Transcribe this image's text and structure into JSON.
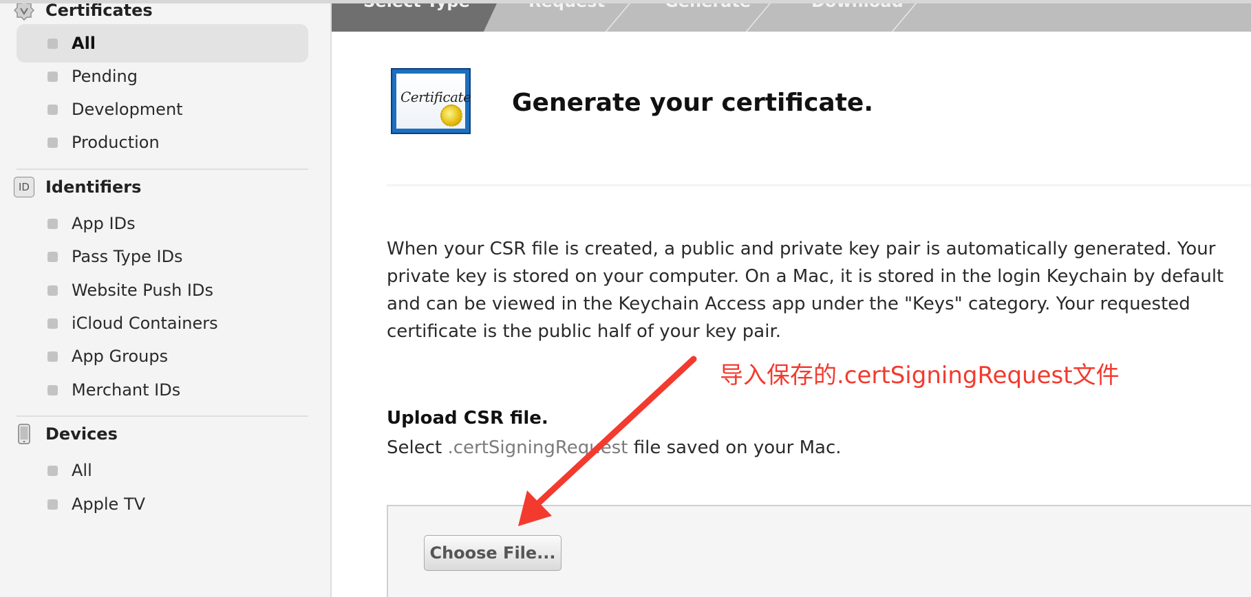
{
  "sidebar": {
    "certificates": {
      "title": "Certificates",
      "items": [
        {
          "label": "All",
          "active": true
        },
        {
          "label": "Pending"
        },
        {
          "label": "Development"
        },
        {
          "label": "Production"
        }
      ]
    },
    "identifiers": {
      "icon_text": "ID",
      "title": "Identifiers",
      "items": [
        {
          "label": "App IDs"
        },
        {
          "label": "Pass Type IDs"
        },
        {
          "label": "Website Push IDs"
        },
        {
          "label": "iCloud Containers"
        },
        {
          "label": "App Groups"
        },
        {
          "label": "Merchant IDs"
        }
      ]
    },
    "devices": {
      "title": "Devices",
      "items": [
        {
          "label": "All"
        },
        {
          "label": "Apple TV"
        }
      ]
    }
  },
  "steps": [
    "Select Type",
    "Request",
    "Generate",
    "Download"
  ],
  "main": {
    "certificate_icon_text": "Certificate",
    "title": "Generate your certificate.",
    "description": "When your CSR file is created, a public and private key pair is automatically generated. Your private key is stored on your computer. On a Mac, it is stored in the login Keychain by default and can be viewed in the Keychain Access app under the \"Keys\" category. Your requested certificate is the public half of your key pair.",
    "annotation": "导入保存的.certSigningRequest文件",
    "upload": {
      "heading": "Upload CSR file.",
      "sub_prefix": "Select ",
      "sub_ext": ".certSigningRequest",
      "sub_suffix": " file saved on your Mac.",
      "button_label": "Choose File..."
    }
  },
  "colors": {
    "annotation": "#f33a2e",
    "active_step": "#6f6f6f",
    "steps_bar": "#bdbdbd"
  }
}
